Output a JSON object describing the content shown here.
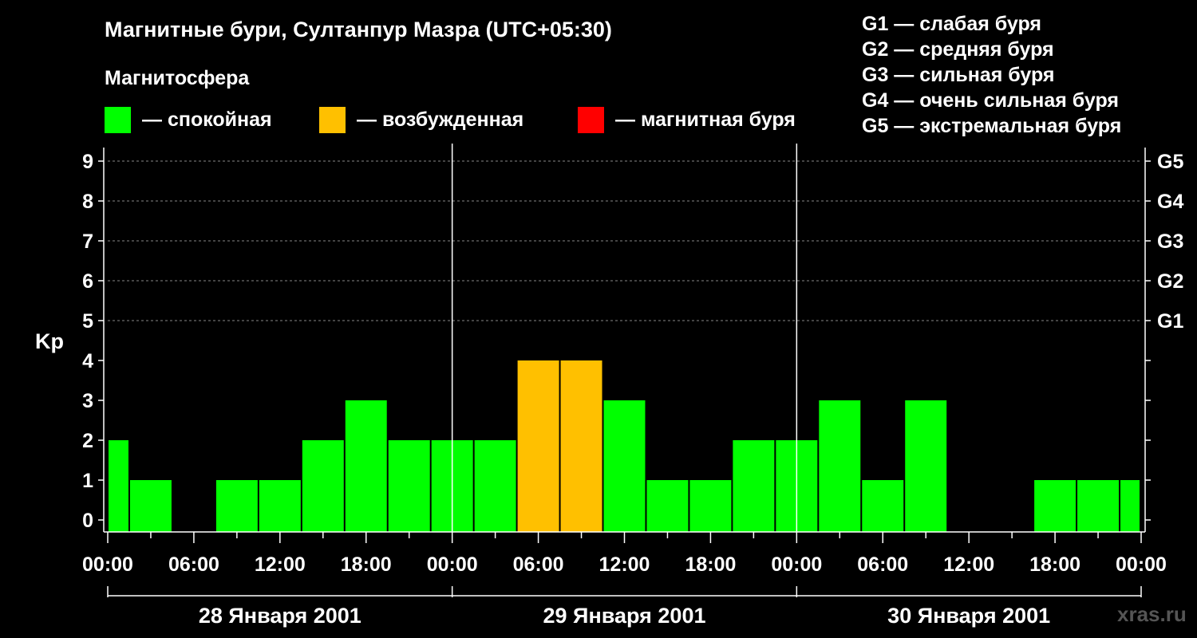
{
  "title": "Магнитные бури, Султанпур Мазра (UTC+05:30)",
  "legend": {
    "heading": "Магнитосфера",
    "items": [
      {
        "color": "#00ff00",
        "label": "— спокойная"
      },
      {
        "color": "#ffc000",
        "label": "— возбужденная"
      },
      {
        "color": "#ff0000",
        "label": "— магнитная буря"
      }
    ]
  },
  "g_scale": [
    "G1 — слабая буря",
    "G2 — средняя буря",
    "G3 — сильная буря",
    "G4 — очень сильная буря",
    "G5 — экстремальная буря"
  ],
  "watermark": "xras.ru",
  "chart_data": {
    "type": "bar",
    "ylabel": "Kp",
    "ylim": [
      0,
      9
    ],
    "y_ticks": [
      "0",
      "1",
      "2",
      "3",
      "4",
      "5",
      "6",
      "7",
      "8",
      "9"
    ],
    "right_axis_labels": [
      {
        "y": 5,
        "label": "G1"
      },
      {
        "y": 6,
        "label": "G2"
      },
      {
        "y": 7,
        "label": "G3"
      },
      {
        "y": 8,
        "label": "G4"
      },
      {
        "y": 9,
        "label": "G5"
      }
    ],
    "x_tick_labels": [
      "00:00",
      "06:00",
      "12:00",
      "18:00",
      "00:00",
      "06:00",
      "12:00",
      "18:00",
      "00:00",
      "06:00",
      "12:00",
      "18:00",
      "00:00"
    ],
    "days": [
      "28 Января 2001",
      "29 Января 2001",
      "30 Января 2001"
    ],
    "grid": "dashed horizontal at Kp 5–9",
    "bars": [
      {
        "start": "28.01 00:00",
        "end": "28.01 01:30",
        "kp": 2,
        "color": "#00ff00"
      },
      {
        "start": "28.01 01:30",
        "end": "28.01 04:30",
        "kp": 1,
        "color": "#00ff00"
      },
      {
        "start": "28.01 04:30",
        "end": "28.01 07:30",
        "kp": 0,
        "color": "#00ff00"
      },
      {
        "start": "28.01 07:30",
        "end": "28.01 10:30",
        "kp": 1,
        "color": "#00ff00"
      },
      {
        "start": "28.01 10:30",
        "end": "28.01 13:30",
        "kp": 1,
        "color": "#00ff00"
      },
      {
        "start": "28.01 13:30",
        "end": "28.01 16:30",
        "kp": 2,
        "color": "#00ff00"
      },
      {
        "start": "28.01 16:30",
        "end": "28.01 19:30",
        "kp": 3,
        "color": "#00ff00"
      },
      {
        "start": "28.01 19:30",
        "end": "28.01 22:30",
        "kp": 2,
        "color": "#00ff00"
      },
      {
        "start": "28.01 22:30",
        "end": "29.01 01:30",
        "kp": 2,
        "color": "#00ff00"
      },
      {
        "start": "29.01 01:30",
        "end": "29.01 04:30",
        "kp": 2,
        "color": "#00ff00"
      },
      {
        "start": "29.01 04:30",
        "end": "29.01 07:30",
        "kp": 4,
        "color": "#ffc000"
      },
      {
        "start": "29.01 07:30",
        "end": "29.01 10:30",
        "kp": 4,
        "color": "#ffc000"
      },
      {
        "start": "29.01 10:30",
        "end": "29.01 13:30",
        "kp": 3,
        "color": "#00ff00"
      },
      {
        "start": "29.01 13:30",
        "end": "29.01 16:30",
        "kp": 1,
        "color": "#00ff00"
      },
      {
        "start": "29.01 16:30",
        "end": "29.01 19:30",
        "kp": 1,
        "color": "#00ff00"
      },
      {
        "start": "29.01 19:30",
        "end": "29.01 22:30",
        "kp": 2,
        "color": "#00ff00"
      },
      {
        "start": "29.01 22:30",
        "end": "30.01 01:30",
        "kp": 2,
        "color": "#00ff00"
      },
      {
        "start": "30.01 01:30",
        "end": "30.01 04:30",
        "kp": 3,
        "color": "#00ff00"
      },
      {
        "start": "30.01 04:30",
        "end": "30.01 07:30",
        "kp": 1,
        "color": "#00ff00"
      },
      {
        "start": "30.01 07:30",
        "end": "30.01 10:30",
        "kp": 3,
        "color": "#00ff00"
      },
      {
        "start": "30.01 10:30",
        "end": "30.01 13:30",
        "kp": 0,
        "color": "#00ff00"
      },
      {
        "start": "30.01 13:30",
        "end": "30.01 16:30",
        "kp": 0,
        "color": "#00ff00"
      },
      {
        "start": "30.01 16:30",
        "end": "30.01 19:30",
        "kp": 1,
        "color": "#00ff00"
      },
      {
        "start": "30.01 19:30",
        "end": "30.01 22:30",
        "kp": 1,
        "color": "#00ff00"
      },
      {
        "start": "30.01 22:30",
        "end": "31.01 00:00",
        "kp": 1,
        "color": "#00ff00"
      }
    ]
  }
}
